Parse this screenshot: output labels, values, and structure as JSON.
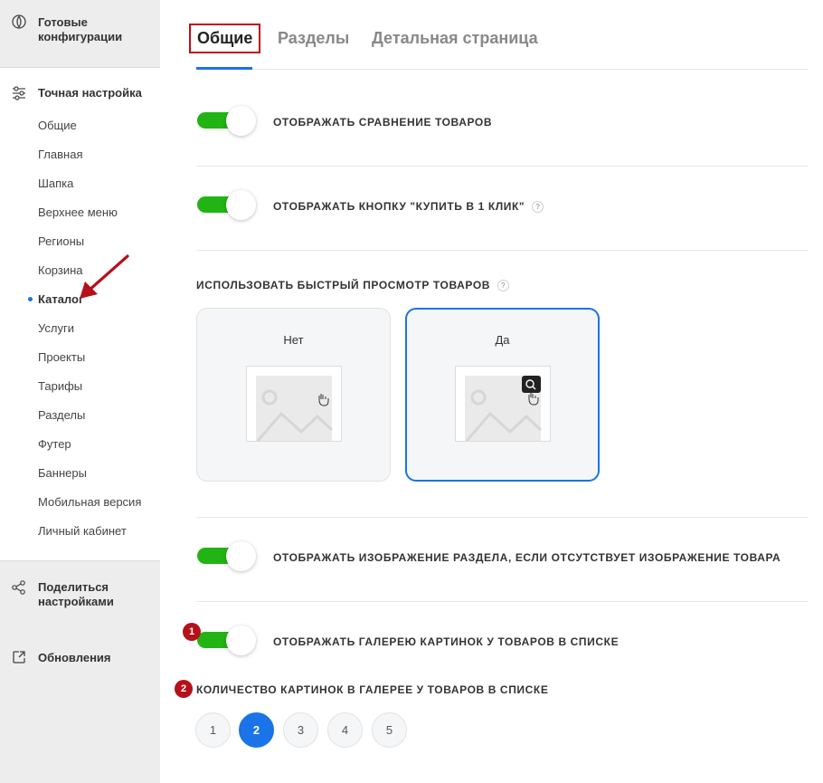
{
  "sidebar": {
    "top_link": "Готовые конфигурации",
    "fine_tuning_heading": "Точная настройка",
    "items": [
      {
        "label": "Общие"
      },
      {
        "label": "Главная"
      },
      {
        "label": "Шапка"
      },
      {
        "label": "Верхнее меню"
      },
      {
        "label": "Регионы"
      },
      {
        "label": "Корзина"
      },
      {
        "label": "Каталог"
      },
      {
        "label": "Услуги"
      },
      {
        "label": "Проекты"
      },
      {
        "label": "Тарифы"
      },
      {
        "label": "Разделы"
      },
      {
        "label": "Футер"
      },
      {
        "label": "Баннеры"
      },
      {
        "label": "Мобильная версия"
      },
      {
        "label": "Личный кабинет"
      }
    ],
    "active_item": "Каталог",
    "share_link": "Поделиться настройками",
    "updates_link": "Обновления"
  },
  "tabs": {
    "items": [
      {
        "label": "Общие"
      },
      {
        "label": "Разделы"
      },
      {
        "label": "Детальная страница"
      }
    ],
    "active": "Общие"
  },
  "settings": {
    "compare": {
      "label": "ОТОБРАЖАТЬ СРАВНЕНИЕ ТОВАРОВ",
      "enabled": true
    },
    "buy_one_click": {
      "label": "ОТОБРАЖАТЬ КНОПКУ \"КУПИТЬ В 1 КЛИК\"",
      "help": "?",
      "enabled": true
    },
    "quick_view": {
      "label": "ИСПОЛЬЗОВАТЬ БЫСТРЫЙ ПРОСМОТР ТОВАРОВ",
      "help": "?",
      "options": [
        {
          "label": "Нет"
        },
        {
          "label": "Да"
        }
      ],
      "selected": "Да"
    },
    "section_image": {
      "label": "ОТОБРАЖАТЬ ИЗОБРАЖЕНИЕ РАЗДЕЛА, ЕСЛИ ОТСУТСТВУЕТ ИЗОБРАЖЕНИЕ ТОВАРА",
      "enabled": true
    },
    "gallery": {
      "label": "ОТОБРАЖАТЬ ГАЛЕРЕЮ КАРТИНОК У ТОВАРОВ В СПИСКЕ",
      "enabled": true,
      "badge": "1"
    },
    "gallery_count": {
      "label": "КОЛИЧЕСТВО КАРТИНОК В ГАЛЕРЕЕ У ТОВАРОВ В СПИСКЕ",
      "badge": "2",
      "options": [
        "1",
        "2",
        "3",
        "4",
        "5"
      ],
      "selected": "2"
    }
  },
  "colors": {
    "accent": "#1a73e8",
    "toggle_on": "#22b414",
    "annotation": "#b5111a"
  }
}
